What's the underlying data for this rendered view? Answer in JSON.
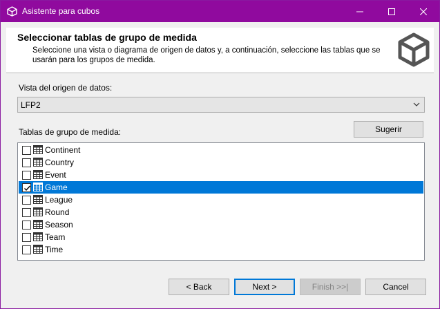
{
  "window": {
    "title": "Asistente para cubos"
  },
  "header": {
    "title": "Seleccionar tablas de grupo de medida",
    "description": "Seleccione una vista o diagrama de origen de datos y, a continuación, seleccione las tablas que se usarán para los grupos de medida."
  },
  "dsv": {
    "label": "Vista del origen de datos:",
    "value": "LFP2"
  },
  "tables": {
    "label": "Tablas de grupo de medida:",
    "suggest_label": "Sugerir",
    "items": [
      {
        "name": "Continent",
        "checked": false,
        "selected": false
      },
      {
        "name": "Country",
        "checked": false,
        "selected": false
      },
      {
        "name": "Event",
        "checked": false,
        "selected": false
      },
      {
        "name": "Game",
        "checked": true,
        "selected": true
      },
      {
        "name": "League",
        "checked": false,
        "selected": false
      },
      {
        "name": "Round",
        "checked": false,
        "selected": false
      },
      {
        "name": "Season",
        "checked": false,
        "selected": false
      },
      {
        "name": "Team",
        "checked": false,
        "selected": false
      },
      {
        "name": "Time",
        "checked": false,
        "selected": false
      }
    ]
  },
  "footer": {
    "back_label": "< Back",
    "next_label": "Next >",
    "finish_label": "Finish >>|",
    "cancel_label": "Cancel"
  },
  "colors": {
    "titlebar": "#900a9e",
    "selection": "#0078d7"
  }
}
